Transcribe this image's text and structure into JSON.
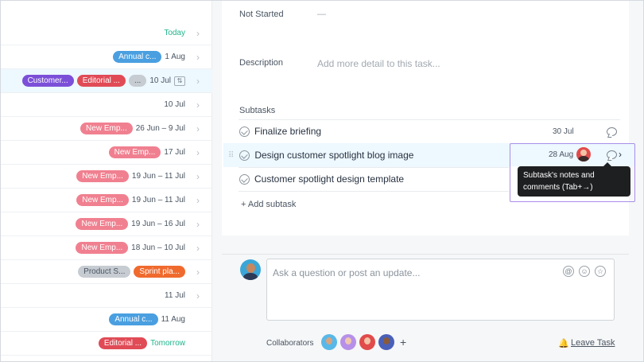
{
  "left_rows": [
    {
      "due": "Today",
      "due_color": "#1fb58b",
      "tags": []
    },
    {
      "due": "1 Aug",
      "tags": [
        {
          "label": "Annual c...",
          "color": "blue"
        }
      ]
    },
    {
      "due": "10 Jul",
      "selected": true,
      "subtask_icon": true,
      "tags": [
        {
          "label": "Customer...",
          "color": "purple"
        },
        {
          "label": "Editorial ...",
          "color": "red"
        },
        {
          "label": "...",
          "color": "gray"
        }
      ]
    },
    {
      "due": "10 Jul",
      "tags": []
    },
    {
      "due": "26 Jun – 9 Jul",
      "tags": [
        {
          "label": "New Emp...",
          "color": "pink"
        }
      ]
    },
    {
      "due": "17 Jul",
      "tags": [
        {
          "label": "New Emp...",
          "color": "pink"
        }
      ]
    },
    {
      "due": "19 Jun – 11 Jul",
      "tags": [
        {
          "label": "New Emp...",
          "color": "pink"
        }
      ]
    },
    {
      "due": "19 Jun – 11 Jul",
      "tags": [
        {
          "label": "New Emp...",
          "color": "pink"
        }
      ]
    },
    {
      "due": "19 Jun – 16 Jul",
      "tags": [
        {
          "label": "New Emp...",
          "color": "pink"
        }
      ]
    },
    {
      "due": "18 Jun – 10 Jul",
      "tags": [
        {
          "label": "New Emp...",
          "color": "pink"
        }
      ]
    },
    {
      "due": "",
      "tags": [
        {
          "label": "Product S...",
          "color": "gray"
        },
        {
          "label": "Sprint pla...",
          "color": "orange"
        }
      ]
    },
    {
      "due": "11 Jul",
      "tags": []
    },
    {
      "due": "11 Aug",
      "no_chevron": true,
      "tags": [
        {
          "label": "Annual c...",
          "color": "blue"
        }
      ]
    },
    {
      "due": "Tomorrow",
      "due_color": "#1fb58b",
      "no_chevron": true,
      "tags": [
        {
          "label": "Editorial ...",
          "color": "red"
        }
      ]
    }
  ],
  "detail": {
    "status_label": "Not Started",
    "status_value": "—",
    "description_label": "Description",
    "description_placeholder": "Add more detail to this task...",
    "subtasks_label": "Subtasks",
    "subtasks": [
      {
        "title": "Finalize briefing",
        "due": "30 Jul"
      },
      {
        "title": "Design customer spotlight blog image",
        "due": "28 Aug",
        "selected": true
      },
      {
        "title": "Customer spotlight design template",
        "due": ""
      }
    ],
    "add_subtask": "+ Add subtask",
    "tooltip": "Subtask's notes and comments (Tab+→)"
  },
  "comment": {
    "placeholder": "Ask a question or post an update...",
    "collaborators_label": "Collaborators",
    "add_collaborator": "+",
    "leave_task": "Leave Task"
  },
  "colors": {
    "blue": "#4a9fe0",
    "purple": "#7c4fd8",
    "red": "#e04b56",
    "gray": "#c6ccd2",
    "pink": "#f08090",
    "orange": "#f06a2e"
  },
  "icons": [
    "chevron-right-icon",
    "subtask-icon",
    "check-circle-icon",
    "comment-icon",
    "drag-handle-icon",
    "at-icon",
    "emoji-icon",
    "star-icon",
    "bell-icon"
  ]
}
